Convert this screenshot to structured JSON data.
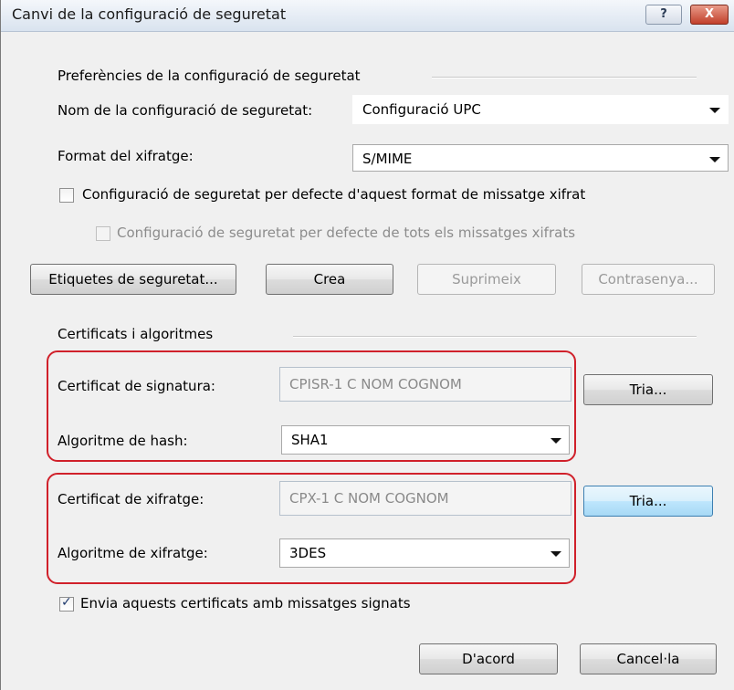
{
  "window": {
    "title": "Canvi de la configuració de seguretat",
    "help": "?",
    "close": "X"
  },
  "prefs": {
    "group_title": "Preferències de la configuració de seguretat",
    "name_label": "Nom de la configuració de seguretat:",
    "name_value": "Configuració UPC",
    "format_label": "Format del xifratge:",
    "format_value": "S/MIME",
    "default_format_label": "Configuració de seguretat per defecte d'aquest format de missatge xifrat",
    "default_all_label": "Configuració de seguretat per defecte de tots els missatges xifrats",
    "default_format_checked": false,
    "default_all_checked": false
  },
  "buttons": {
    "labels": "Etiquetes de seguretat...",
    "create": "Crea",
    "delete": "Suprimeix",
    "password": "Contrasenya...",
    "ok": "D'acord",
    "cancel": "Cancel·la"
  },
  "certs": {
    "group_title": "Certificats i algoritmes",
    "signing_label": "Certificat de signatura:",
    "signing_value": "CPISR-1 C NOM COGNOM",
    "signing_choose": "Tria...",
    "hash_label": "Algoritme de hash:",
    "hash_value": "SHA1",
    "encryption_label": "Certificat de xifratge:",
    "encryption_value": "CPX-1 C NOM COGNOM",
    "encryption_choose": "Tria...",
    "enc_alg_label": "Algoritme de xifratge:",
    "enc_alg_value": "3DES"
  },
  "send_certs": {
    "label": "Envia aquests certificats amb missatges signats",
    "checked": true
  },
  "colors": {
    "highlight": "#d0202a",
    "titlebar": "#d9e3ef"
  }
}
